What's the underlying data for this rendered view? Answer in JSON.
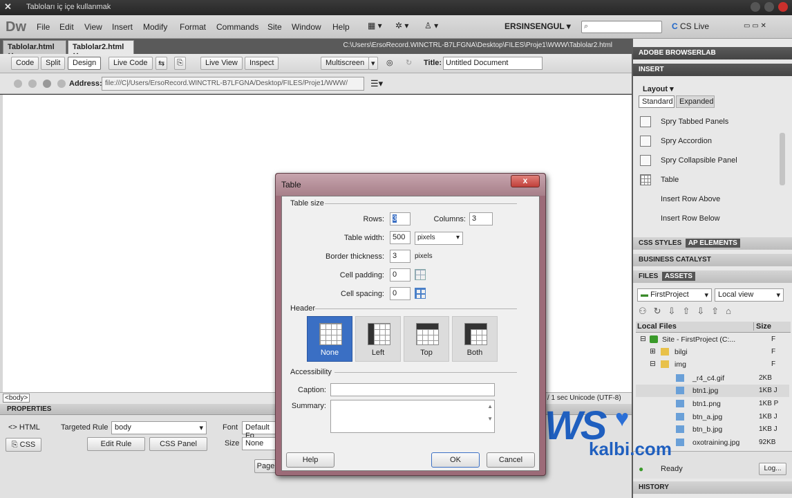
{
  "window": {
    "title": "Tabloları iç içe kullanmak"
  },
  "menubar": {
    "app_logo": "Dw",
    "items": [
      "File",
      "Edit",
      "View",
      "Insert",
      "Modify",
      "Format",
      "Commands",
      "Site",
      "Window",
      "Help"
    ],
    "user": "ERSINSENGUL",
    "cs_live": "CS Live"
  },
  "doc_tabs": {
    "tabs": [
      "Tablolar.html",
      "Tablolar2.html"
    ],
    "path": "C:\\Users\\ErsoRecord.WINCTRL-B7LFGNA\\Desktop\\FILES\\Proje1\\WWW\\Tablolar2.html"
  },
  "doc_toolbar": {
    "code": "Code",
    "split": "Split",
    "design": "Design",
    "live_code": "Live Code",
    "live_view": "Live View",
    "inspect": "Inspect",
    "multiscreen": "Multiscreen",
    "title_label": "Title:",
    "title_value": "Untitled Document"
  },
  "address": {
    "label": "Address:",
    "value": "file:///C|/Users/ErsoRecord.WINCTRL-B7LFGNA/Desktop/FILES/Proje1/WWW/"
  },
  "status": {
    "tag": "<body>",
    "right": "/ 1 sec  Unicode (UTF-8)"
  },
  "properties": {
    "header": "PROPERTIES",
    "html": "HTML",
    "css": "CSS",
    "targeted_rule_label": "Targeted Rule",
    "targeted_rule_value": "body",
    "edit_rule": "Edit Rule",
    "css_panel": "CSS Panel",
    "font_label": "Font",
    "font_value": "Default Fo",
    "size_label": "Size",
    "size_value": "None",
    "page_btn": "Page"
  },
  "right_panel": {
    "browserlab": "ADOBE BROWSERLAB",
    "insert": "INSERT",
    "layout": "Layout",
    "standard": "Standard",
    "expanded": "Expanded",
    "insert_items": [
      "Spry Tabbed Panels",
      "Spry Accordion",
      "Spry Collapsible Panel",
      "Table",
      "Insert Row Above",
      "Insert Row Below"
    ],
    "css_styles": "CSS STYLES",
    "ap_elements": "AP ELEMENTS",
    "business_catalyst": "BUSINESS CATALYST",
    "files_tab": "FILES",
    "assets_tab": "ASSETS",
    "site_select": "FirstProject",
    "view_select": "Local view",
    "local_files": "Local Files",
    "size_col": "Size",
    "files": [
      {
        "name": "Site - FirstProject (C:...",
        "size": "F"
      },
      {
        "name": "bilgi",
        "size": "F"
      },
      {
        "name": "img",
        "size": "F"
      },
      {
        "name": "_r4_c4.gif",
        "size": "2KB"
      },
      {
        "name": "btn1.jpg",
        "size": "1KB J"
      },
      {
        "name": "btn1.png",
        "size": "1KB P"
      },
      {
        "name": "btn_a.jpg",
        "size": "1KB J"
      },
      {
        "name": "btn_b.jpg",
        "size": "1KB J"
      },
      {
        "name": "oxotraining.jpg",
        "size": "92KB"
      }
    ],
    "ready": "Ready",
    "log": "Log...",
    "history": "HISTORY"
  },
  "dialog": {
    "title": "Table",
    "close": "x",
    "table_size": "Table size",
    "rows_label": "Rows:",
    "rows_value": "3",
    "columns_label": "Columns:",
    "columns_value": "3",
    "width_label": "Table width:",
    "width_value": "500",
    "width_unit": "pixels",
    "border_label": "Border thickness:",
    "border_value": "3",
    "border_unit": "pixels",
    "padding_label": "Cell padding:",
    "padding_value": "0",
    "spacing_label": "Cell spacing:",
    "spacing_value": "0",
    "header": "Header",
    "header_options": [
      "None",
      "Left",
      "Top",
      "Both"
    ],
    "accessibility": "Accessibility",
    "caption_label": "Caption:",
    "summary_label": "Summary:",
    "help": "Help",
    "ok": "OK",
    "cancel": "Cancel"
  },
  "watermark": {
    "big": "WS",
    "small": "kalbi.com"
  }
}
